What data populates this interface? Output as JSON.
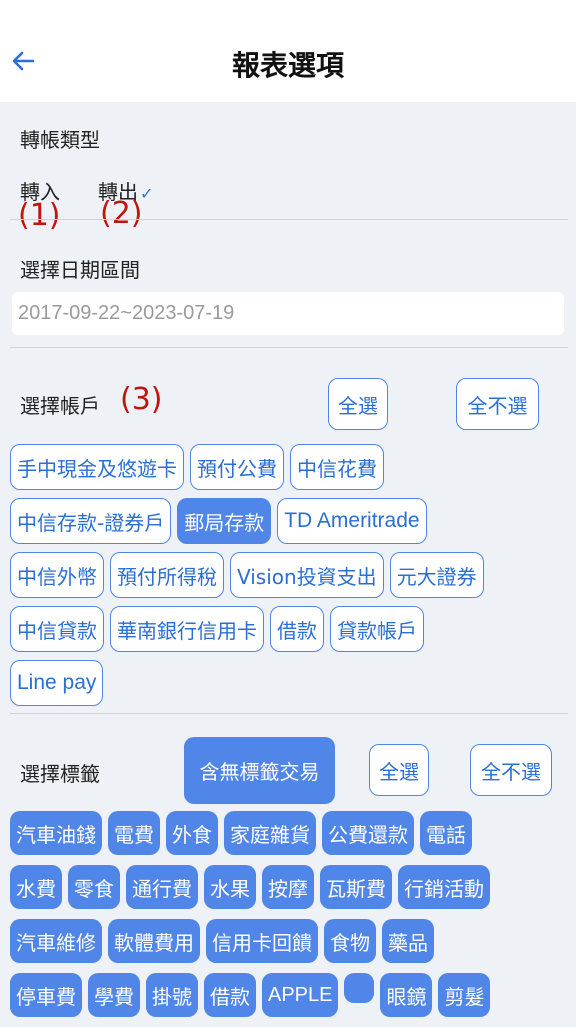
{
  "header": {
    "title": "報表選項",
    "back_icon": "arrow-left-icon"
  },
  "transfer_type": {
    "label": "轉帳類型",
    "options": [
      {
        "label": "轉入",
        "checked": false
      },
      {
        "label": "轉出",
        "checked": true,
        "check_mark": "✓"
      }
    ]
  },
  "annotations": [
    "(1)",
    "(2)",
    "(3)"
  ],
  "date_range": {
    "label": "選擇日期區間",
    "value": "2017-09-22~2023-07-19"
  },
  "accounts": {
    "label": "選擇帳戶",
    "select_all": "全選",
    "select_none": "全不選",
    "rows": [
      [
        "手中現金及悠遊卡",
        "預付公費",
        "中信花費"
      ],
      [
        "中信存款-證券戶",
        "郵局存款",
        "TD Ameritrade"
      ],
      [
        "中信外幣",
        "預付所得稅",
        "Vision投資支出",
        "元大證券"
      ],
      [
        "中信貸款",
        "華南銀行信用卡",
        "借款",
        "貸款帳戶"
      ],
      [
        "Line pay"
      ]
    ],
    "selected": [
      "郵局存款"
    ]
  },
  "tags": {
    "label": "選擇標籤",
    "include_untagged": "含無標籤交易",
    "select_all": "全選",
    "select_none": "全不選",
    "rows": [
      [
        "汽車油錢",
        "電費",
        "外食",
        "家庭雜貨",
        "公費還款",
        "電話"
      ],
      [
        "水費",
        "零食",
        "通行費",
        "水果",
        "按摩",
        "瓦斯費",
        "行銷活動"
      ],
      [
        "汽車維修",
        "軟體費用",
        "信用卡回饋",
        "食物",
        "藥品"
      ],
      [
        "停車費",
        "學費",
        "掛號",
        "借款",
        "APPLE",
        "",
        "眼鏡",
        "剪髮"
      ]
    ]
  },
  "colors": {
    "accent": "#4f86e8",
    "annotation": "#c0140c",
    "background": "#eef1f6"
  }
}
